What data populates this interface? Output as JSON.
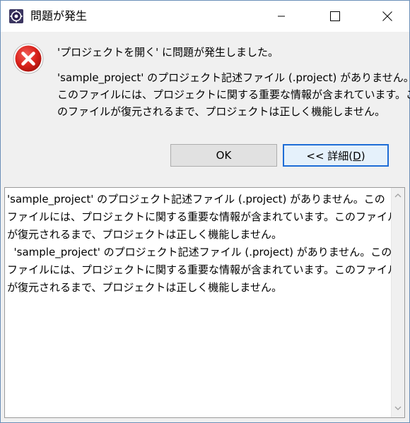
{
  "window": {
    "title": "問題が発生",
    "icons": {
      "app": "eclipse-gear-icon",
      "minimize": "minimize-icon",
      "maximize": "maximize-icon",
      "close": "close-icon"
    }
  },
  "dialog": {
    "error_icon": "error-icon",
    "error_color": "#d9221b",
    "title": "'プロジェクトを開く' に問題が発生しました。",
    "body_lines": [
      "'sample_project' のプロジェクト記述ファイル (.project) がありません。",
      "このファイルには、プロジェクトに関する重要な情報が含まれています。こ",
      "のファイルが復元されるまで、プロジェクトは正しく機能しません。"
    ]
  },
  "buttons": {
    "ok_label": "OK",
    "details_prefix": "<< 詳細(",
    "details_mnemonic": "D",
    "details_suffix": ")",
    "accent_color": "#1e6dd6"
  },
  "details": {
    "lines": [
      "'sample_project' のプロジェクト記述ファイル (.project) がありません。この",
      "ファイルには、プロジェクトに関する重要な情報が含まれています。このファイル",
      "が復元されるまで、プロジェクトは正しく機能しません。",
      "  'sample_project' のプロジェクト記述ファイル (.project) がありません。この",
      "ファイルには、プロジェクトに関する重要な情報が含まれています。このファイル",
      "が復元されるまで、プロジェクトは正しく機能しません。"
    ]
  }
}
